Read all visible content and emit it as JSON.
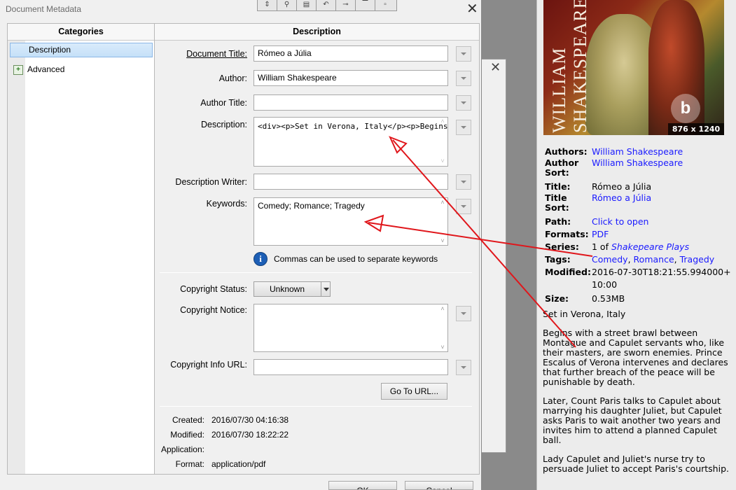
{
  "dialog": {
    "title": "Document Metadata",
    "close_glyph": "✕",
    "toolbar_icons": [
      "arrows-icon",
      "pin-icon",
      "save-icon",
      "undo-icon",
      "plug-icon",
      "minimize-icon",
      "restore-icon"
    ]
  },
  "categories": {
    "header": "Categories",
    "items": [
      {
        "label": "Description",
        "selected": true
      },
      {
        "label": "Advanced",
        "selected": false
      }
    ]
  },
  "description": {
    "header": "Description",
    "document_title": {
      "label": "Document Title:",
      "value": "Rómeo a Júlia"
    },
    "author": {
      "label": "Author:",
      "value": "William Shakespeare"
    },
    "author_title": {
      "label": "Author Title:",
      "value": ""
    },
    "description": {
      "label": "Description:",
      "value": "<div><p>Set in Verona, Italy</p><p>Begins w"
    },
    "description_writer": {
      "label": "Description Writer:",
      "value": ""
    },
    "keywords": {
      "label": "Keywords:",
      "value": "Comedy; Romance; Tragedy"
    },
    "keywords_hint": "Commas can be used to separate keywords",
    "copyright_status": {
      "label": "Copyright Status:",
      "value": "Unknown"
    },
    "copyright_notice": {
      "label": "Copyright Notice:",
      "value": ""
    },
    "copyright_url": {
      "label": "Copyright Info URL:",
      "value": ""
    },
    "go_to_url": "Go To URL...",
    "created": {
      "label": "Created:",
      "value": "2016/07/30 04:16:38"
    },
    "modified": {
      "label": "Modified:",
      "value": "2016/07/30 18:22:22"
    },
    "application": {
      "label": "Application:",
      "value": ""
    },
    "format": {
      "label": "Format:",
      "value": "application/pdf"
    }
  },
  "buttons": {
    "ok": "OK",
    "cancel": "Cancel"
  },
  "cover": {
    "title": "WILLIAM SHAKESPEARE",
    "size": "876 x 1240",
    "logo": "b"
  },
  "book": {
    "authors_k": "Authors:",
    "authors": "William Shakespeare",
    "author_sort_k": "Author Sort:",
    "author_sort": "William Shakespeare",
    "title_k": "Title:",
    "title": "Rómeo a Júlia",
    "title_sort_k": "Title Sort:",
    "title_sort": "Rómeo a Júlia",
    "path_k": "Path:",
    "path": "Click to open",
    "formats_k": "Formats:",
    "formats": "PDF",
    "series_k": "Series:",
    "series_prefix": "1 of",
    "series": "Shakepeare Plays",
    "tags_k": "Tags:",
    "tags": [
      "Comedy",
      "Romance",
      "Tragedy"
    ],
    "tags_sep": ",",
    "modified_k": "Modified:",
    "modified": "2016-07-30T18:21:55.994000+10:00",
    "size_k": "Size:",
    "size": "0.53MB",
    "paragraphs": [
      "Set in Verona, Italy",
      "Begins with a street brawl between Montague and Capulet servants who, like their masters, are sworn enemies. Prince Escalus of Verona intervenes and declares that further breach of the peace will be punishable by death.",
      "Later, Count Paris talks to Capulet about marrying his daughter Juliet, but Capulet asks Paris to wait another two years and invites him to attend a planned Capulet ball.",
      "Lady Capulet and Juliet's nurse try to persuade Juliet to accept Paris's courtship."
    ]
  },
  "colors": {
    "annotation": "#e0161b",
    "link": "#1a1aff",
    "selection": "#c5e0f8"
  }
}
